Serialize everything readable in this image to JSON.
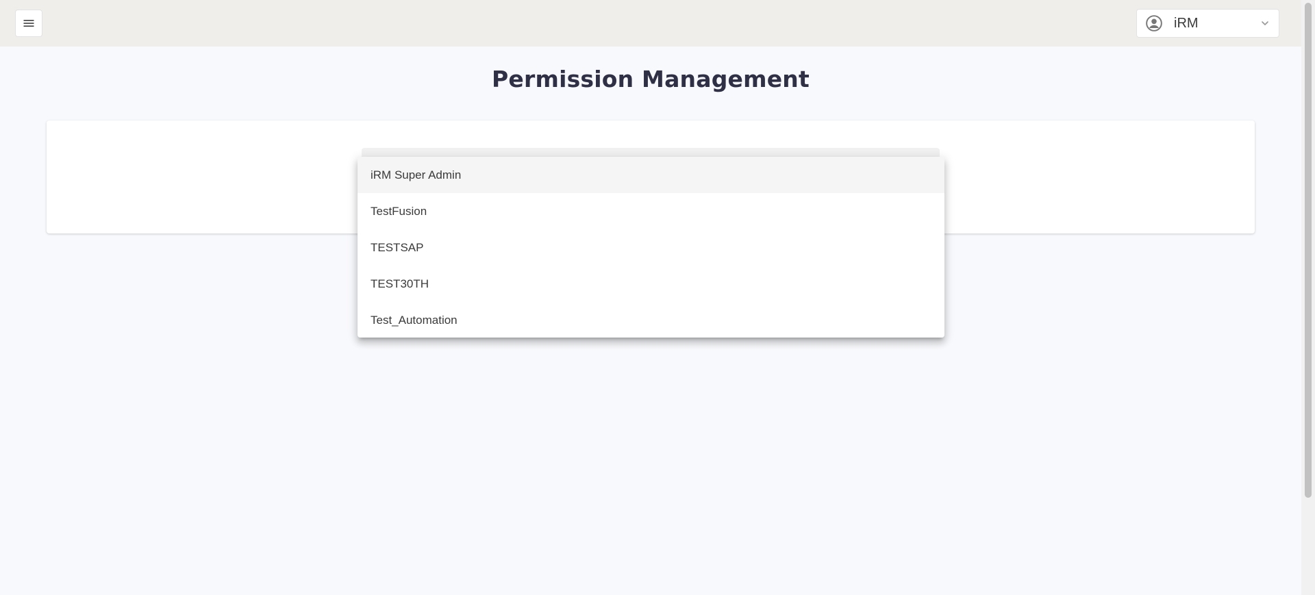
{
  "header": {
    "menu_icon": "hamburger-menu-icon",
    "user": {
      "icon": "account-circle-icon",
      "name": "iRM",
      "chevron": "chevron-down-icon"
    }
  },
  "page": {
    "title": "Permission Management"
  },
  "dropdown": {
    "options": [
      {
        "label": "iRM Super Admin",
        "selected": true
      },
      {
        "label": "TestFusion",
        "selected": false
      },
      {
        "label": "TESTSAP",
        "selected": false
      },
      {
        "label": "TEST30TH",
        "selected": false
      },
      {
        "label": "Test_Automation",
        "selected": false
      }
    ]
  },
  "colors": {
    "topbar": "#f0eeeb",
    "page_bg": "#f8f9fc",
    "title": "#2f2f45"
  }
}
